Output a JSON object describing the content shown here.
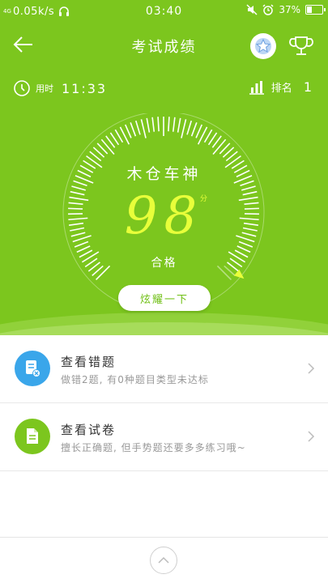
{
  "status_bar": {
    "network": "4G",
    "speed": "0.05k/s",
    "time": "03:40",
    "battery_percent": "37%",
    "battery_level": 0.37,
    "icons": [
      "headset-icon",
      "mute-icon",
      "alarm-icon",
      "battery-icon"
    ]
  },
  "header": {
    "title": "考试成绩",
    "icons": [
      "back-arrow-icon",
      "star-icon",
      "trophy-icon"
    ]
  },
  "info": {
    "time_label": "用时",
    "time_value": "11:33",
    "rank_label": "排名",
    "rank_value": "1"
  },
  "result": {
    "name": "木仓车神",
    "score": "98",
    "score_unit": "分",
    "status": "合格",
    "gauge_fraction": 0.98,
    "show_off_label": "炫耀一下"
  },
  "list": [
    {
      "title": "查看错题",
      "subtitle": "做错2题, 有0种题目类型未达标",
      "icon": "wrong-answers-icon",
      "color": "#3aa6ea"
    },
    {
      "title": "查看试卷",
      "subtitle": "擅长正确题, 但手势题还要多多练习哦~",
      "icon": "exam-paper-icon",
      "color": "#7cc61e"
    }
  ],
  "colors": {
    "primary": "#7cc61e",
    "score": "#e8ff3a",
    "blue": "#3aa6ea"
  }
}
